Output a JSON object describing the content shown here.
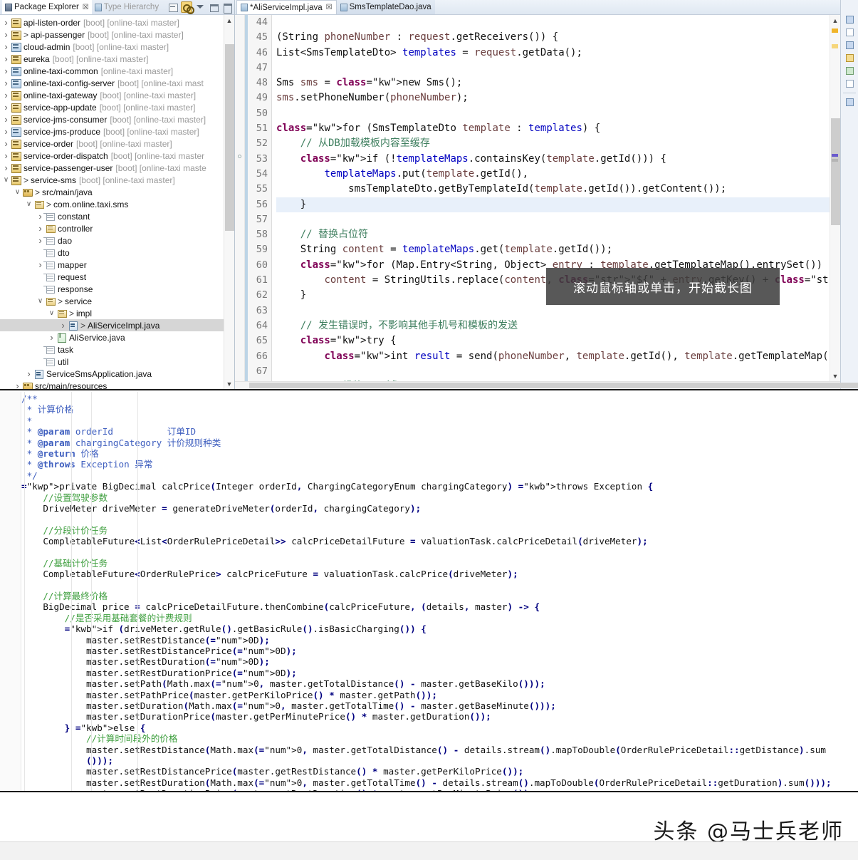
{
  "package_explorer": {
    "tabs": [
      {
        "label": "Package Explorer",
        "icon": "package-explorer-icon",
        "active": true
      },
      {
        "label": "Type Hierarchy",
        "icon": "type-hierarchy-icon",
        "active": false
      }
    ],
    "toolbar": [
      {
        "name": "collapse-all-button",
        "title": "Collapse All"
      },
      {
        "name": "link-with-editor-button",
        "title": "Link with Editor"
      },
      {
        "name": "view-menu-button",
        "title": "View Menu"
      },
      {
        "name": "minimize-button",
        "title": "Minimize"
      },
      {
        "name": "maximize-button",
        "title": "Maximize"
      }
    ],
    "tree": [
      {
        "indent": 0,
        "arrow": "r",
        "icon": "proj",
        "gt": "",
        "name": "api-listen-order",
        "meta": "[boot] [online-taxi master]"
      },
      {
        "indent": 0,
        "arrow": "r",
        "icon": "proj",
        "gt": ">",
        "name": "api-passenger",
        "meta": "[boot] [online-taxi master]"
      },
      {
        "indent": 0,
        "arrow": "r",
        "icon": "proj2",
        "gt": "",
        "name": "cloud-admin",
        "meta": "[boot] [online-taxi master]"
      },
      {
        "indent": 0,
        "arrow": "r",
        "icon": "proj",
        "gt": "",
        "name": "eureka",
        "meta": "[boot] [online-taxi master]"
      },
      {
        "indent": 0,
        "arrow": "r",
        "icon": "proj2",
        "gt": "",
        "name": "online-taxi-common",
        "meta": "[online-taxi master]"
      },
      {
        "indent": 0,
        "arrow": "r",
        "icon": "proj2",
        "gt": "",
        "name": "online-taxi-config-server",
        "meta": "[boot] [online-taxi mast"
      },
      {
        "indent": 0,
        "arrow": "r",
        "icon": "proj",
        "gt": "",
        "name": "online-taxi-gateway",
        "meta": "[boot] [online-taxi master]"
      },
      {
        "indent": 0,
        "arrow": "r",
        "icon": "proj",
        "gt": "",
        "name": "service-app-update",
        "meta": "[boot] [online-taxi master]"
      },
      {
        "indent": 0,
        "arrow": "r",
        "icon": "proj",
        "gt": "",
        "name": "service-jms-consumer",
        "meta": "[boot] [online-taxi master]"
      },
      {
        "indent": 0,
        "arrow": "r",
        "icon": "proj2",
        "gt": "",
        "name": "service-jms-produce",
        "meta": "[boot] [online-taxi master]"
      },
      {
        "indent": 0,
        "arrow": "r",
        "icon": "proj",
        "gt": "",
        "name": "service-order",
        "meta": "[boot] [online-taxi master]"
      },
      {
        "indent": 0,
        "arrow": "r",
        "icon": "proj",
        "gt": "",
        "name": "service-order-dispatch",
        "meta": "[boot] [online-taxi master"
      },
      {
        "indent": 0,
        "arrow": "r",
        "icon": "proj",
        "gt": "",
        "name": "service-passenger-user",
        "meta": "[boot] [online-taxi maste"
      },
      {
        "indent": 0,
        "arrow": "d",
        "icon": "proj",
        "gt": ">",
        "name": "service-sms",
        "meta": "[boot] [online-taxi master]"
      },
      {
        "indent": 1,
        "arrow": "d",
        "icon": "src",
        "gt": ">",
        "name": "src/main/java",
        "meta": ""
      },
      {
        "indent": 2,
        "arrow": "d",
        "icon": "pkg",
        "gt": ">",
        "name": "com.online.taxi.sms",
        "meta": ""
      },
      {
        "indent": 3,
        "arrow": "r",
        "icon": "epkg",
        "gt": "",
        "name": "constant",
        "meta": ""
      },
      {
        "indent": 3,
        "arrow": "r",
        "icon": "pkg",
        "gt": "",
        "name": "controller",
        "meta": ""
      },
      {
        "indent": 3,
        "arrow": "r",
        "icon": "epkg",
        "gt": "",
        "name": "dao",
        "meta": ""
      },
      {
        "indent": 3,
        "arrow": "none",
        "icon": "epkg",
        "gt": "",
        "name": "dto",
        "meta": ""
      },
      {
        "indent": 3,
        "arrow": "r",
        "icon": "epkg",
        "gt": "",
        "name": "mapper",
        "meta": ""
      },
      {
        "indent": 3,
        "arrow": "none",
        "icon": "epkg",
        "gt": "",
        "name": "request",
        "meta": ""
      },
      {
        "indent": 3,
        "arrow": "none",
        "icon": "epkg",
        "gt": "",
        "name": "response",
        "meta": ""
      },
      {
        "indent": 3,
        "arrow": "d",
        "icon": "pkg",
        "gt": ">",
        "name": "service",
        "meta": ""
      },
      {
        "indent": 4,
        "arrow": "d",
        "icon": "pkg",
        "gt": ">",
        "name": "impl",
        "meta": ""
      },
      {
        "indent": 5,
        "arrow": "r",
        "icon": "java",
        "gt": ">",
        "name": "AliServiceImpl.java",
        "meta": "",
        "selected": true
      },
      {
        "indent": 4,
        "arrow": "r",
        "icon": "iface",
        "gt": "",
        "name": "AliService.java",
        "meta": ""
      },
      {
        "indent": 3,
        "arrow": "none",
        "icon": "epkg",
        "gt": "",
        "name": "task",
        "meta": ""
      },
      {
        "indent": 3,
        "arrow": "none",
        "icon": "epkg",
        "gt": "",
        "name": "util",
        "meta": ""
      },
      {
        "indent": 2,
        "arrow": "r",
        "icon": "java",
        "gt": "",
        "name": "ServiceSmsApplication.java",
        "meta": ""
      },
      {
        "indent": 1,
        "arrow": "r",
        "icon": "src",
        "gt": "",
        "name": "src/main/resources",
        "meta": ""
      }
    ]
  },
  "editor": {
    "tabs": [
      {
        "label": "*AliServiceImpl.java",
        "icon": "java-file-icon",
        "active": true,
        "dirty": true,
        "close": "☒"
      },
      {
        "label": "SmsTemplateDao.java",
        "icon": "java-file-icon",
        "active": false,
        "dirty": false
      }
    ],
    "first_line_number": 44,
    "highlighted_line": 56,
    "lines": [
      {
        "n": 44,
        "text": ""
      },
      {
        "n": 45,
        "text": "(String phoneNumber : request.getReceivers()) {"
      },
      {
        "n": 46,
        "text": "List<SmsTemplateDto> templates = request.getData();"
      },
      {
        "n": 47,
        "text": ""
      },
      {
        "n": 48,
        "text": "Sms sms = new Sms();"
      },
      {
        "n": 49,
        "text": "sms.setPhoneNumber(phoneNumber);"
      },
      {
        "n": 50,
        "text": ""
      },
      {
        "n": 51,
        "text": "for (SmsTemplateDto template : templates) {"
      },
      {
        "n": 52,
        "text": "    // 从DB加载模板内容至缓存"
      },
      {
        "n": 53,
        "text": "    if (!templateMaps.containsKey(template.getId())) {"
      },
      {
        "n": 54,
        "text": "        templateMaps.put(template.getId(),"
      },
      {
        "n": 55,
        "text": "            smsTemplateDto.getByTemplateId(template.getId()).getContent());"
      },
      {
        "n": 56,
        "text": "    }"
      },
      {
        "n": 57,
        "text": ""
      },
      {
        "n": 58,
        "text": "    // 替换占位符"
      },
      {
        "n": 59,
        "text": "    String content = templateMaps.get(template.getId());"
      },
      {
        "n": 60,
        "text": "    for (Map.Entry<String, Object> entry : template.getTemplateMap().entrySet()) {"
      },
      {
        "n": 61,
        "text": "        content = StringUtils.replace(content, \"${\" + entry.getKey() + \"}\", \"\" + e"
      },
      {
        "n": 62,
        "text": "    }"
      },
      {
        "n": 63,
        "text": ""
      },
      {
        "n": 64,
        "text": "    // 发生错误时，不影响其他手机号和模板的发送"
      },
      {
        "n": 65,
        "text": "    try {"
      },
      {
        "n": 66,
        "text": "        int result = send(phoneNumber, template.getId(), template.getTemplateMap()"
      },
      {
        "n": 67,
        "text": ""
      },
      {
        "n": 68,
        "text": "        // 组装SMS对象"
      }
    ]
  },
  "capture_tooltip": {
    "text": "滚动鼠标轴或单击，开始截长图"
  },
  "bottom_code": {
    "lines": [
      "/**",
      " * 计算价格",
      " *",
      " * @param orderId          订单ID",
      " * @param chargingCategory 计价规则种类",
      " * @return 价格",
      " * @throws Exception 异常",
      " */",
      "private BigDecimal calcPrice(Integer orderId, ChargingCategoryEnum chargingCategory) throws Exception {",
      "    //设置驾驶参数",
      "    DriveMeter driveMeter = generateDriveMeter(orderId, chargingCategory);",
      "",
      "    //分段计价任务",
      "    CompletableFuture<List<OrderRulePriceDetail>> calcPriceDetailFuture = valuationTask.calcPriceDetail(driveMeter);",
      "",
      "    //基础计价任务",
      "    CompletableFuture<OrderRulePrice> calcPriceFuture = valuationTask.calcPrice(driveMeter);",
      "",
      "    //计算最终价格",
      "    BigDecimal price = calcPriceDetailFuture.thenCombine(calcPriceFuture, (details, master) -> {",
      "        //是否采用基础套餐的计费规则",
      "        if (driveMeter.getRule().getBasicRule().isBasicCharging()) {",
      "            master.setRestDistance(0D);",
      "            master.setRestDistancePrice(0D);",
      "            master.setRestDuration(0D);",
      "            master.setRestDurationPrice(0D);",
      "            master.setPath(Math.max(0, master.getTotalDistance() - master.getBaseKilo()));",
      "            master.setPathPrice(master.getPerKiloPrice() * master.getPath());",
      "            master.setDuration(Math.max(0, master.getTotalTime() - master.getBaseMinute()));",
      "            master.setDurationPrice(master.getPerMinutePrice() * master.getDuration());",
      "        } else {",
      "            //计算时间段外的价格",
      "            master.setRestDistance(Math.max(0, master.getTotalDistance() - details.stream().mapToDouble(OrderRulePriceDetail::getDistance).sum",
      "            ()));",
      "            master.setRestDistancePrice(master.getRestDistance() * master.getPerKiloPrice());",
      "            master.setRestDuration(Math.max(0, master.getTotalTime() - details.stream().mapToDouble(OrderRulePriceDetail::getDuration).sum()));",
      "            master.setRestDurationPrice(master.getRestDuration() * master.getPerMinutePrice());"
    ]
  },
  "footer": {
    "watermark": "头条 @马士兵老师"
  }
}
